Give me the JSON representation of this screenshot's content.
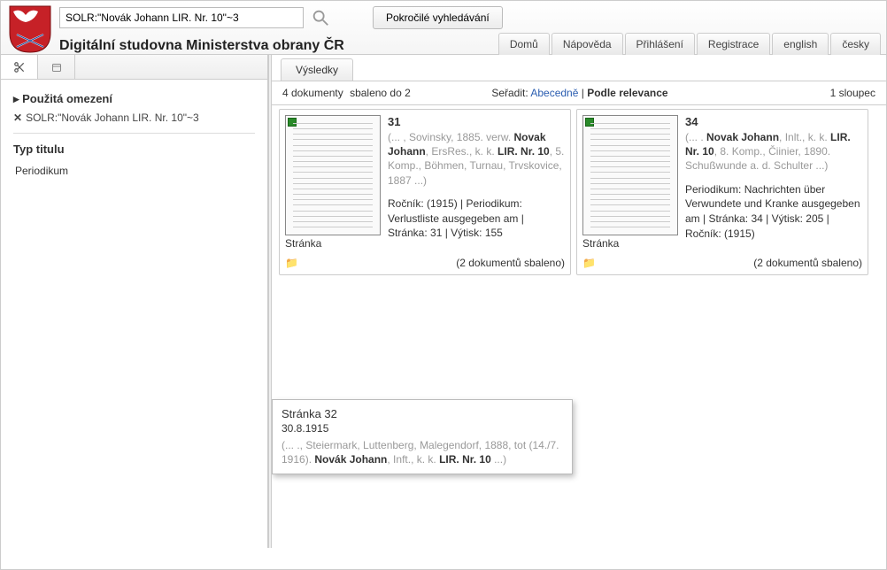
{
  "header": {
    "search_value": "SOLR:\"Novák Johann LIR. Nr. 10\"~3",
    "adv_search": "Pokročilé vyhledávání",
    "site_title": "Digitální studovna Ministerstva obrany ČR",
    "nav": [
      "Domů",
      "Nápověda",
      "Přihlášení",
      "Registrace",
      "english",
      "česky"
    ]
  },
  "sidebar": {
    "filters_title": "Použitá omezení",
    "filter_item": "SOLR:\"Novák Johann LIR. Nr. 10\"~3",
    "type_title": "Typ titulu",
    "type_item": "Periodikum"
  },
  "results": {
    "tab": "Výsledky",
    "count": "4 dokumenty",
    "packed": "sbaleno do 2",
    "sort_label": "Seřadit:",
    "sort_alpha": "Abecedně",
    "sort_rel": "Podle relevance",
    "cols": "1 sloupec"
  },
  "cards": [
    {
      "title": "31",
      "snippet_pre": "(... , Sovinsky, 1885. verw. ",
      "snippet_bold1": "Novak Johann",
      "snippet_mid": ", ErsRes., k. k. ",
      "snippet_bold2": "LIR. Nr. 10",
      "snippet_post": ", 5. Komp., Böhmen, Turnau, Trvskovice, 1887 ...)",
      "meta": "Ročník:   (1915)    |   Periodikum: Verlustliste ausgegeben am    |   Stránka: 31     |   Výtisk: 155",
      "thumb_label": "Stránka",
      "footer": "(2 dokumentů sbaleno)"
    },
    {
      "title": "34",
      "snippet_pre": "(... . ",
      "snippet_bold1": "Novak Johann",
      "snippet_mid": ", Inlt., k. k. ",
      "snippet_bold2": "LIR. Nr. 10",
      "snippet_post": ", 8. Komp., Čiinier, 1890. Schußwunde a. d. Schulter ...)",
      "meta": "Periodikum: Nachrichten über Verwundete und Kranke ausgegeben am    |   Stránka: 34     |   Výtisk: 205    |   Ročník:   (1915)",
      "thumb_label": "Stránka",
      "footer": "(2 dokumentů sbaleno)"
    }
  ],
  "popup": {
    "title": "Stránka  32",
    "sub": "30.8.1915",
    "snip_pre": "(... ., Steiermark, Luttenberg, Malegendorf, 1888, tot (14./7. 1916). ",
    "snip_bold1": "Novák Johann",
    "snip_mid": ", Inft., k. k. ",
    "snip_bold2": "LIR. Nr. 10",
    "snip_post": " ...)"
  }
}
